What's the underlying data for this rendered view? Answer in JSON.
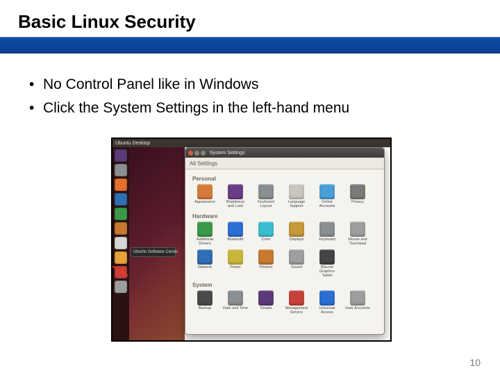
{
  "title": "Basic Linux Security",
  "bullets": [
    "No Control Panel like in Windows",
    "Click the System Settings in the left-hand menu"
  ],
  "page_number": "10",
  "screenshot": {
    "desktop_top_left": "Ubuntu Desktop",
    "launcher": [
      {
        "name": "dash",
        "color": "#5b3b7a"
      },
      {
        "name": "files",
        "color": "#8b8f92"
      },
      {
        "name": "firefox",
        "color": "#e76f2a"
      },
      {
        "name": "writer",
        "color": "#2f6fb5"
      },
      {
        "name": "calc",
        "color": "#3a9a4a"
      },
      {
        "name": "impress",
        "color": "#c77a2f"
      },
      {
        "name": "software",
        "color": "#d7d7d7"
      },
      {
        "name": "amazon",
        "color": "#e6a13b"
      },
      {
        "name": "settings",
        "color": "#c7403a"
      },
      {
        "name": "trash",
        "color": "#9e9e9e"
      }
    ],
    "software_tooltip": "Ubuntu Software Center",
    "settings_window": {
      "title": "System Settings",
      "toolbar_label": "All Settings",
      "sections": [
        {
          "heading": "Personal",
          "items": [
            {
              "label": "Appearance",
              "color": "#d57a3a"
            },
            {
              "label": "Brightness and Lock",
              "color": "#6a3e86"
            },
            {
              "label": "Keyboard Layout",
              "color": "#8a8f94"
            },
            {
              "label": "Language Support",
              "color": "#c9c6bf"
            },
            {
              "label": "Online Accounts",
              "color": "#4b9fd8"
            },
            {
              "label": "Privacy",
              "color": "#7a7a7a"
            }
          ]
        },
        {
          "heading": "Hardware",
          "items": [
            {
              "label": "Additional Drivers",
              "color": "#3a9a4a"
            },
            {
              "label": "Bluetooth",
              "color": "#2b6fd4"
            },
            {
              "label": "Color",
              "color": "#3bbed1"
            },
            {
              "label": "Displays",
              "color": "#c49a3a"
            },
            {
              "label": "Keyboard",
              "color": "#8a8f94"
            },
            {
              "label": "Mouse and Touchpad",
              "color": "#9e9e9e"
            },
            {
              "label": "Network",
              "color": "#2f6fb5"
            },
            {
              "label": "Power",
              "color": "#c7b63a"
            },
            {
              "label": "Printers",
              "color": "#c77a2f"
            },
            {
              "label": "Sound",
              "color": "#9e9e9e"
            },
            {
              "label": "Wacom Graphics Tablet",
              "color": "#444"
            }
          ]
        },
        {
          "heading": "System",
          "items": [
            {
              "label": "Backup",
              "color": "#4a4a4a"
            },
            {
              "label": "Date and Time",
              "color": "#8a8f94"
            },
            {
              "label": "Details",
              "color": "#5b3b7a"
            },
            {
              "label": "Management Service",
              "color": "#c7403a"
            },
            {
              "label": "Universal Access",
              "color": "#2b6fd4"
            },
            {
              "label": "User Accounts",
              "color": "#9e9e9e"
            }
          ]
        }
      ]
    }
  }
}
